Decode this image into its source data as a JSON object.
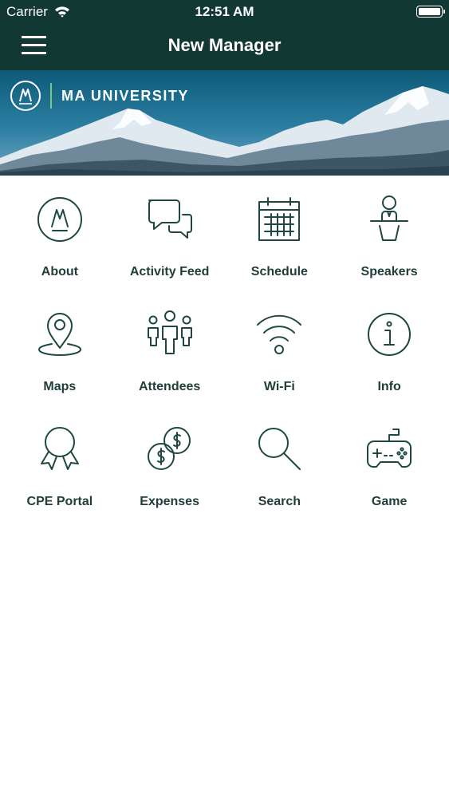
{
  "status_bar": {
    "carrier": "Carrier",
    "time": "12:51 AM"
  },
  "nav": {
    "title": "New Manager",
    "menu_icon": "hamburger-menu-icon"
  },
  "banner": {
    "brand": "MA UNIVERSITY",
    "logo_icon": "ma-logo-icon"
  },
  "colors": {
    "header_bg": "#123833",
    "icon_stroke": "#1e4841",
    "label": "#213e3a",
    "accent": "#7fc77a"
  },
  "tiles": [
    {
      "label": "About",
      "icon": "ma-logo-icon"
    },
    {
      "label": "Activity Feed",
      "icon": "chat-bubbles-icon"
    },
    {
      "label": "Schedule",
      "icon": "calendar-icon"
    },
    {
      "label": "Speakers",
      "icon": "speaker-podium-icon"
    },
    {
      "label": "Maps",
      "icon": "map-pin-icon"
    },
    {
      "label": "Attendees",
      "icon": "people-icon"
    },
    {
      "label": "Wi-Fi",
      "icon": "wifi-icon"
    },
    {
      "label": "Info",
      "icon": "info-icon"
    },
    {
      "label": "CPE Portal",
      "icon": "award-ribbon-icon"
    },
    {
      "label": "Expenses",
      "icon": "dollar-coins-icon"
    },
    {
      "label": "Search",
      "icon": "search-icon"
    },
    {
      "label": "Game",
      "icon": "game-controller-icon"
    }
  ]
}
